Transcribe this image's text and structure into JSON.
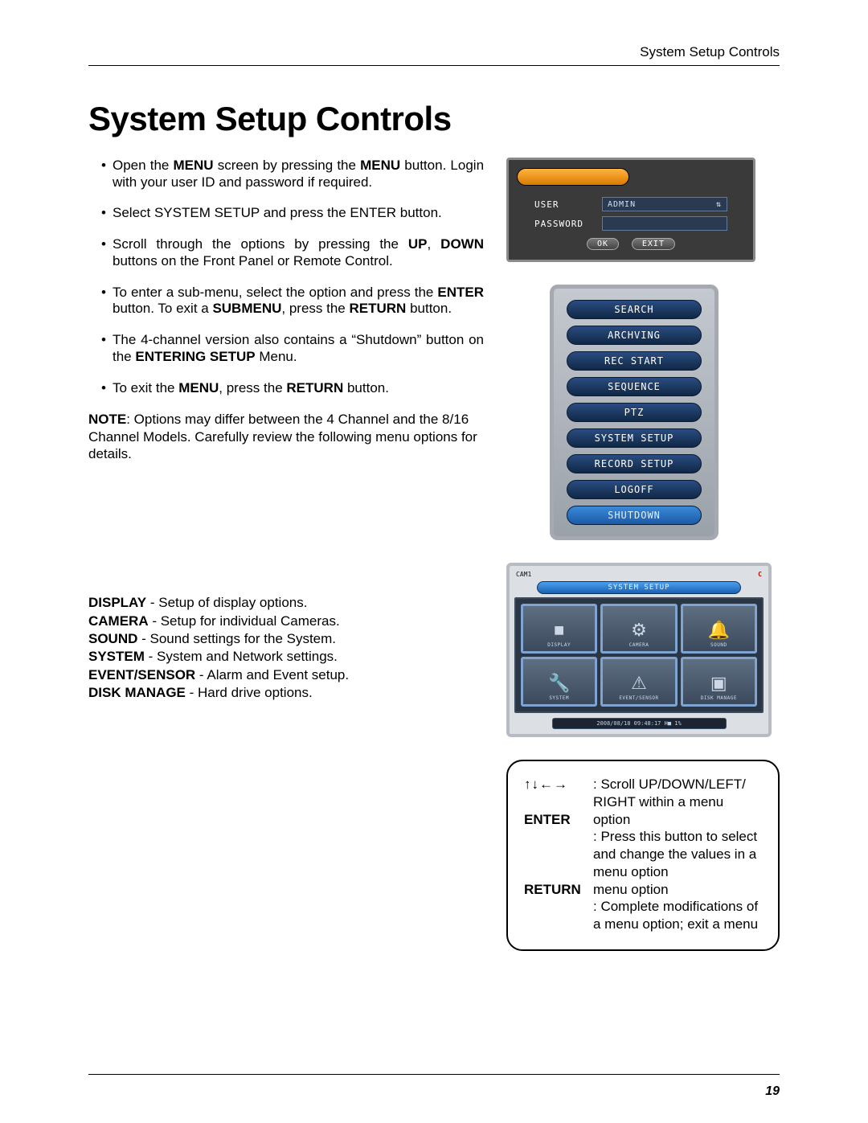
{
  "header": {
    "running": "System Setup Controls"
  },
  "title": "System Setup Controls",
  "bullets": [
    "Open the <b>MENU</b> screen by pressing the <b>MENU</b> button. Login with your user ID and password if required.",
    "Select SYSTEM SETUP and press the ENTER button.",
    "Scroll through the options by pressing the <b>UP</b>, <b>DOWN</b> buttons on the Front Panel or Remote Control.",
    "To enter a sub-menu, select the option and press the <b>ENTER</b> button. To exit a <b>SUBMENU</b>, press the <b>RETURN</b> button.",
    "The 4-channel version also contains a “Shutdown” button on the <b>ENTERING SETUP</b> Menu.",
    "To exit the <b>MENU</b>, press the <b>RETURN</b> button."
  ],
  "note": "<b>NOTE</b>: Options may differ between the 4 Channel and the 8/16 Channel Models. Carefully review the following menu options for details.",
  "defs": [
    "<b>DISPLAY</b> - Setup of display options.",
    "<b>CAMERA</b> - Setup for individual Cameras.",
    "<b>SOUND</b> - Sound settings for the System.",
    "<b>SYSTEM</b> - System and Network settings.",
    "<b>EVENT/SENSOR</b> - Alarm and Event setup.",
    "<b>DISK MANAGE</b> - Hard drive options."
  ],
  "login": {
    "user_label": "USER",
    "user_value": "ADMIN",
    "pwd_label": "PASSWORD",
    "pwd_value": "",
    "ok": "OK",
    "exit": "EXIT"
  },
  "menu_items": [
    {
      "label": "SEARCH",
      "hl": false
    },
    {
      "label": "ARCHVING",
      "hl": false
    },
    {
      "label": "REC START",
      "hl": false
    },
    {
      "label": "SEQUENCE",
      "hl": false
    },
    {
      "label": "PTZ",
      "hl": false
    },
    {
      "label": "SYSTEM SETUP",
      "hl": false
    },
    {
      "label": "RECORD SETUP",
      "hl": false
    },
    {
      "label": "LOGOFF",
      "hl": false
    },
    {
      "label": "SHUTDOWN",
      "hl": true
    }
  ],
  "setup": {
    "cam_label": "CAM1",
    "c_label": "C",
    "title": "SYSTEM SETUP",
    "cells": [
      {
        "icon": "■",
        "cap": "DISPLAY"
      },
      {
        "icon": "⚙",
        "cap": "CAMERA"
      },
      {
        "icon": "🔔",
        "cap": "SOUND"
      },
      {
        "icon": "🔧",
        "cap": "SYSTEM"
      },
      {
        "icon": "⚠",
        "cap": "EVENT/SENSOR"
      },
      {
        "icon": "▣",
        "cap": "DISK MANAGE"
      }
    ],
    "status": "2008/08/18 09:48:17 H■ 1%"
  },
  "instructions": {
    "arrows": "↑↓←→",
    "arrows_txt1": ": Scroll UP/DOWN/LEFT/",
    "arrows_txt2": "RIGHT within a menu",
    "enter_key": "ENTER",
    "enter_txt1": "option",
    "enter_txt2": ": Press this button to select and change the values in a menu option",
    "return_key": "RETURN",
    "return_txt1": "menu option",
    "return_txt2": ": Complete modifications of a menu option; exit a menu"
  },
  "page_number": "19"
}
